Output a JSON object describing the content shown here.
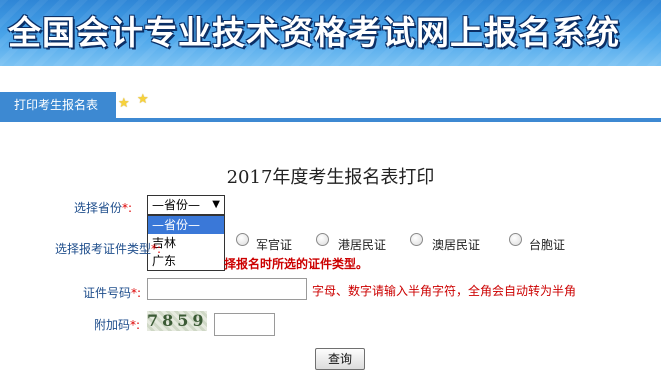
{
  "banner": {
    "title": "全国会计专业技术资格考试网上报名系统"
  },
  "nav": {
    "tab_label": "打印考生报名表"
  },
  "page_title": "2017年度考生报名表打印",
  "form": {
    "province": {
      "label": "选择省份",
      "required_mark": "*:",
      "selected": "—省份—",
      "options": [
        "—省份—",
        "吉林",
        "广东"
      ]
    },
    "id_type": {
      "label": "选择报考证件类型",
      "required_mark": "*:",
      "options": [
        "军官证",
        "港居民证",
        "澳居民证",
        "台胞证"
      ],
      "warning": "择报名时所选的证件类型。"
    },
    "id_number": {
      "label": "证件号码",
      "required_mark": "*:",
      "value": "",
      "hint": "字母、数字请输入半角字符，全角会自动转为半角"
    },
    "captcha": {
      "label": "附加码",
      "required_mark": "*:",
      "image_text": "7859",
      "value": ""
    },
    "submit_label": "查询"
  }
}
